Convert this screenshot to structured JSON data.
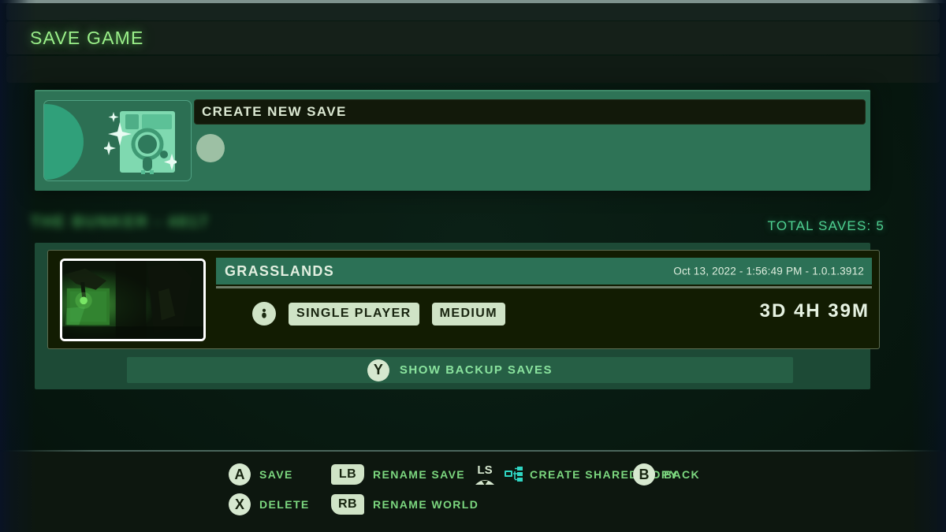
{
  "header": {
    "title": "SAVE GAME"
  },
  "create_save": {
    "input_value": "CREATE NEW SAVE",
    "icon": "floppy-disk-icon"
  },
  "world": {
    "name_blurred": "THE BUNKER - 4817",
    "total_saves_label": "TOTAL SAVES: 5"
  },
  "save_entry": {
    "name": "GRASSLANDS",
    "timestamp": "Oct 13, 2022 - 1:56:49 PM - 1.0.1.3912",
    "mode_tag": "SINGLE PLAYER",
    "difficulty_tag": "MEDIUM",
    "playtime": "3D 4H 39M",
    "info_icon": "player-icon"
  },
  "backup": {
    "button_glyph": "Y",
    "label": "SHOW BACKUP SAVES"
  },
  "footer": {
    "hints": [
      {
        "glyph": "A",
        "type": "circle",
        "label": "SAVE"
      },
      {
        "glyph": "LB",
        "type": "bumper-left",
        "label": "RENAME SAVE"
      },
      {
        "glyph": "LS",
        "type": "stick",
        "label": "CREATE SHARED COPY",
        "extra_icon": "network-share-icon"
      },
      {
        "glyph": "B",
        "type": "circle",
        "label": "BACK"
      },
      {
        "glyph": "X",
        "type": "circle",
        "label": "DELETE"
      },
      {
        "glyph": "RB",
        "type": "bumper-right",
        "label": "RENAME WORLD"
      }
    ]
  },
  "colors": {
    "accent_green": "#9bf08a",
    "panel_teal": "#2e7356",
    "panel_dark": "#121c02",
    "tag_bg": "#cfe3c6",
    "hint_text": "#7cd77f",
    "share_icon": "#2fd6c3"
  }
}
